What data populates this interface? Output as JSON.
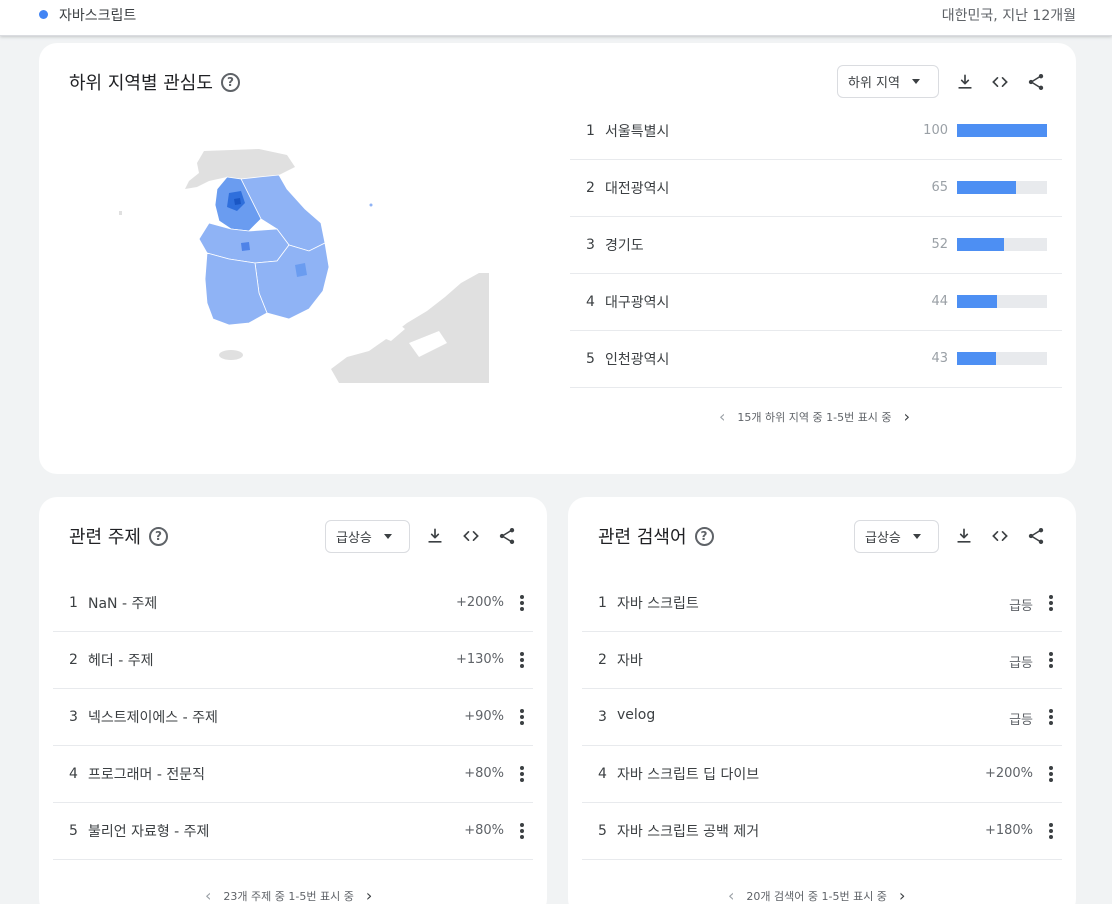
{
  "header": {
    "search_term": "자바스크립트",
    "scope": "대한민국, 지난 12개월"
  },
  "region_card": {
    "title": "하위 지역별 관심도",
    "dropdown": "하위 지역",
    "rows": [
      {
        "rank": "1",
        "name": "서울특별시",
        "value": 100
      },
      {
        "rank": "2",
        "name": "대전광역시",
        "value": 65
      },
      {
        "rank": "3",
        "name": "경기도",
        "value": 52
      },
      {
        "rank": "4",
        "name": "대구광역시",
        "value": 44
      },
      {
        "rank": "5",
        "name": "인천광역시",
        "value": 43
      }
    ],
    "pager": "15개 하위 지역 중 1-5번 표시 중"
  },
  "topics_card": {
    "title": "관련 주제",
    "dropdown": "급상승",
    "rows": [
      {
        "rank": "1",
        "label": "NaN - 주제",
        "value": "+200%"
      },
      {
        "rank": "2",
        "label": "헤더 - 주제",
        "value": "+130%"
      },
      {
        "rank": "3",
        "label": "넥스트제이에스 - 주제",
        "value": "+90%"
      },
      {
        "rank": "4",
        "label": "프로그래머 - 전문직",
        "value": "+80%"
      },
      {
        "rank": "5",
        "label": "불리언 자료형 - 주제",
        "value": "+80%"
      }
    ],
    "pager": "23개 주제 중 1-5번 표시 중"
  },
  "queries_card": {
    "title": "관련 검색어",
    "dropdown": "급상승",
    "rows": [
      {
        "rank": "1",
        "label": "자바 스크립트",
        "value": "급등"
      },
      {
        "rank": "2",
        "label": "자바",
        "value": "급등"
      },
      {
        "rank": "3",
        "label": "velog",
        "value": "급등"
      },
      {
        "rank": "4",
        "label": "자바 스크립트 딥 다이브",
        "value": "+200%"
      },
      {
        "rank": "5",
        "label": "자바 스크립트 공백 제거",
        "value": "+180%"
      }
    ],
    "pager": "20개 검색어 중 1-5번 표시 중"
  },
  "icons": {
    "help": "help-icon",
    "download": "download-icon",
    "embed": "embed-code-icon",
    "share": "share-icon",
    "more": "more-vert-icon",
    "prev": "chevron-left-icon",
    "next": "chevron-right-icon"
  },
  "colors": {
    "accent": "#4285f4",
    "bar": "#4d8ff3",
    "map_high": "#2f6fdc",
    "map_mid": "#6a9cf0",
    "map_low": "#8fb3f5",
    "map_none": "#e0e0e0"
  }
}
